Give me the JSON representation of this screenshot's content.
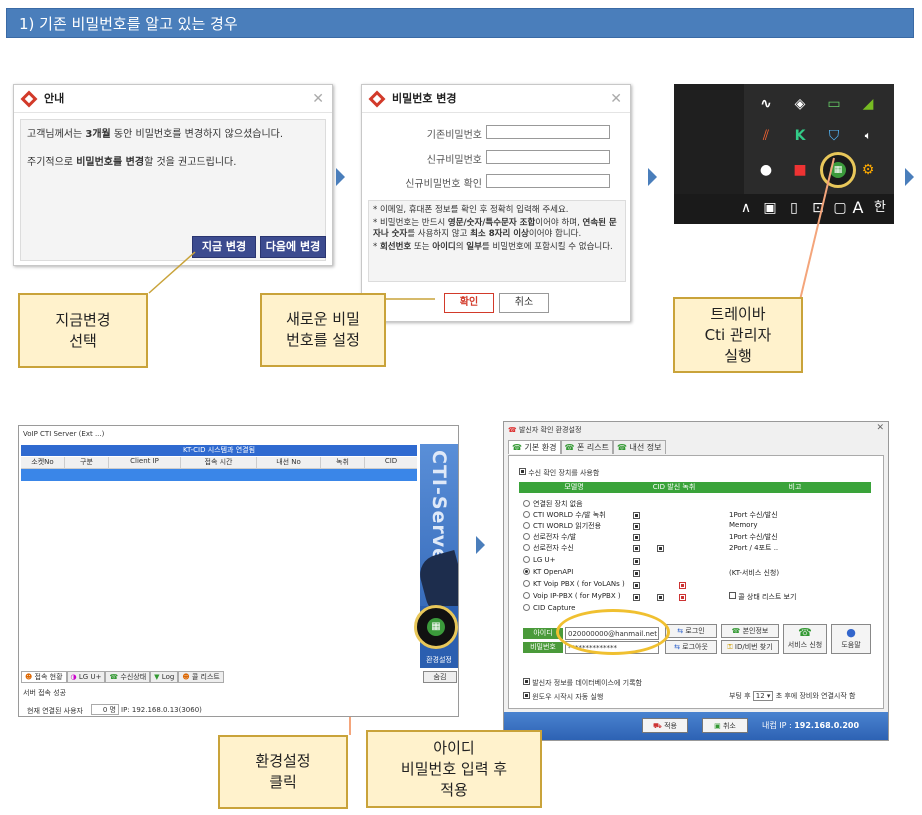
{
  "header": {
    "title": "1)  기존 비밀번호를 알고 있는 경우"
  },
  "notice": {
    "title": "안내",
    "line1_pre": "고객님께서는 ",
    "line1_bold": "3개월",
    "line1_post": " 동안 비밀번호를 변경하지 않으셨습니다.",
    "line2_pre": "주기적으로 ",
    "line2_bold": "비밀번호를 변경",
    "line2_post": "할 것을 권고드립니다.",
    "change_now": "지금 변경",
    "change_later": "다음에 변경"
  },
  "pwchange": {
    "title": "비밀번호 변경",
    "current_label": "기존비밀번호",
    "new_label": "신규비밀번호",
    "confirm_label": "신규비밀번호 확인",
    "note1": "* 이메일, 휴대폰 정보를 확인 후 정확히 입력해 주세요.",
    "note2_a": "* 비밀번호는 반드시 ",
    "note2_b": "영문/숫자/특수문자 조합",
    "note2_c": "이어야 하며, ",
    "note2_d": "연속된 문자나 숫자",
    "note2_e": "를 사용하지 않고 ",
    "note2_f": "최소 8자리 이상",
    "note2_g": "이어야 합니다.",
    "note3_a": "* ",
    "note3_b": "회선번호",
    "note3_c": " 또는 ",
    "note3_d": "아이디",
    "note3_e": "의 ",
    "note3_f": "일부",
    "note3_g": "를 비밀번호에 포함시킬 수 없습니다.",
    "ok": "확인",
    "cancel": "취소"
  },
  "tray": {
    "letter": "A",
    "hangul": "한"
  },
  "callouts": {
    "c1": "지금변경\n선택",
    "c2": "새로운 비밀\n번호를 설정",
    "c3": "트레이바\nCti 관리자\n실행",
    "c4": "환경설정\n클릭",
    "c5": "아이디\n비밀번호 입력 후\n적용"
  },
  "cti": {
    "title": "VoIP CTI Server (Ext ...)",
    "table_title": "KT-CID 시스템과 연결됨",
    "columns": [
      "소켓No",
      "구분",
      "Client IP",
      "접속 시간",
      "내선 No",
      "녹취",
      "CID"
    ],
    "side_text": "CTI-Server",
    "settings_label": "환경설정",
    "tabs": [
      "접속 현황",
      "LG U+",
      "수신상태",
      "Log",
      "콜 리스트"
    ],
    "hide_btn": "숨김",
    "status": "서버 접속 성공",
    "users_label": "현재 연결된 사용자",
    "users_count": "0 명",
    "ip": "IP: 192.168.0.13(3060)"
  },
  "config": {
    "title": "발신자 확인 환경설정",
    "tabs": [
      "기본 환경",
      "폰 리스트",
      "내선 정보"
    ],
    "use_device": "수신 확인 장치를 사용함",
    "col_model": "모델명",
    "col_cid": "CID  발신  녹취",
    "col_note": "비고",
    "rows": [
      {
        "name": "연결된 장치 없음",
        "note": ""
      },
      {
        "name": "CTI WORLD 수/발 녹취",
        "note": "1Port 수신/발신"
      },
      {
        "name": "CTI WORLD 읽기전용",
        "note": "Memory"
      },
      {
        "name": "선로전자 수/발",
        "note": "1Port 수신/발신"
      },
      {
        "name": "선로전자 수신",
        "note": "2Port / 4포트 .."
      },
      {
        "name": "LG U+",
        "note": ""
      },
      {
        "name": "KT OpenAPI",
        "note": "(KT-서비스 신청)"
      },
      {
        "name": "KT Voip PBX ( for VoLANs )",
        "note": ""
      },
      {
        "name": "Voip IP-PBX  ( for MyPBX  )",
        "note": "콜 상태 리스트 보기"
      },
      {
        "name": "CID Capture",
        "note": ""
      }
    ],
    "id_label": "아이디",
    "id_value": "020000000@hanmail.net",
    "pw_label": "비밀번호",
    "pw_value": "**************",
    "login": "로그인",
    "logout": "로그아웃",
    "my_info": "본인정보",
    "find_id": "ID/비번 찾기",
    "service": "서비스 신청",
    "help": "도움말",
    "log_db": "발신자 정보를 데이터베이스에 기록함",
    "autostart": "윈도우 시작시 자동 실행",
    "boot_pre": "부팅 후",
    "boot_val": "12",
    "boot_post": "초 후에 장비와 연결시작 함",
    "apply": "적용",
    "cancel": "취소",
    "ip_label": "내컴 IP :",
    "ip": "192.168.0.200"
  }
}
